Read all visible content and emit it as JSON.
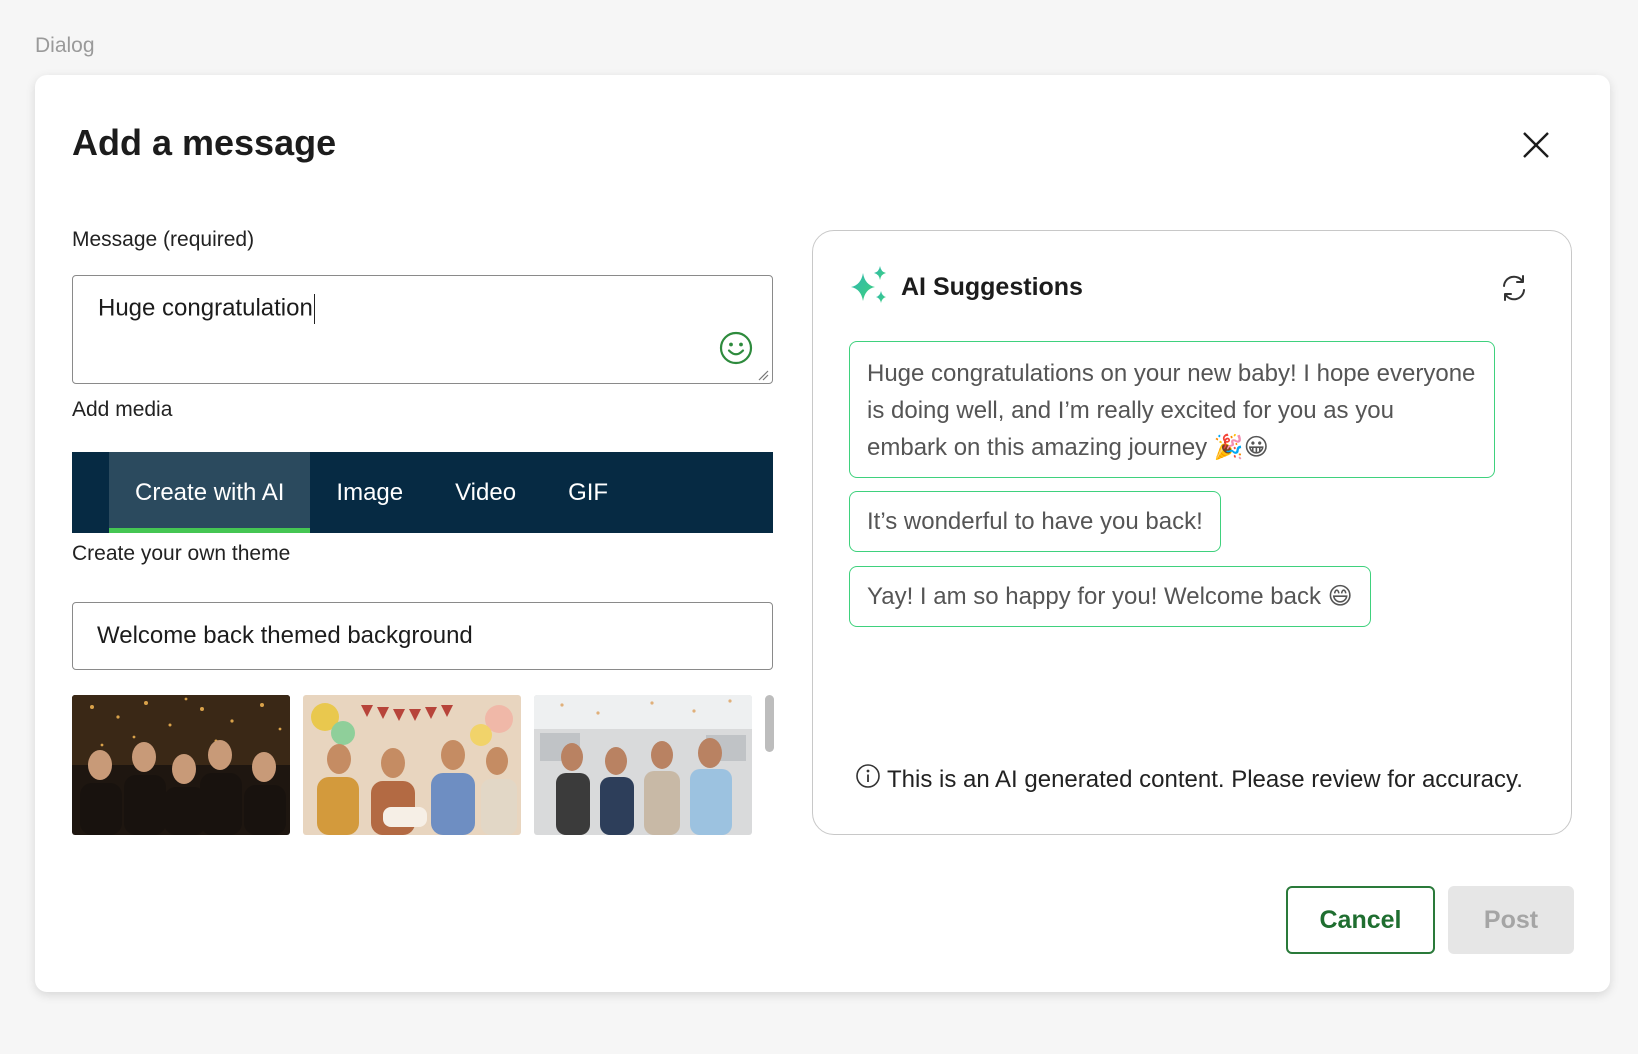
{
  "frame": {
    "label": "Dialog"
  },
  "dialog": {
    "title": "Add a message",
    "message": {
      "label": "Message (required)",
      "value": "Huge congratulation"
    },
    "media": {
      "label": "Add media",
      "tabs": [
        {
          "label": "Create with AI",
          "active": true
        },
        {
          "label": "Image",
          "active": false
        },
        {
          "label": "Video",
          "active": false
        },
        {
          "label": "GIF",
          "active": false
        }
      ]
    },
    "theme": {
      "label": "Create your own theme",
      "value": "Welcome back themed background"
    },
    "thumbnails": [
      {
        "icon": "celebration-confetti-party-image"
      },
      {
        "icon": "welcome-baby-party-image"
      },
      {
        "icon": "office-celebration-image"
      }
    ],
    "ai_panel": {
      "title": "AI Suggestions",
      "suggestions": [
        "Huge congratulations on your new baby! I hope everyone is doing well, and I’m really excited for you as you embark on this amazing journey 🎉😀",
        "It’s wonderful to have you back!",
        "Yay! I am so happy for you! Welcome back 😄"
      ],
      "disclaimer": "This is an AI generated content. Please review for accuracy."
    },
    "buttons": {
      "cancel": "Cancel",
      "post": "Post"
    }
  },
  "colors": {
    "tab_bar": "#062a43",
    "tab_active_bg": "#2b4a5e",
    "tab_active_indicator": "#45c653",
    "suggestion_border": "#3fd17d",
    "cancel_border": "#2a7a3a",
    "post_disabled": "#e6e6e6"
  }
}
